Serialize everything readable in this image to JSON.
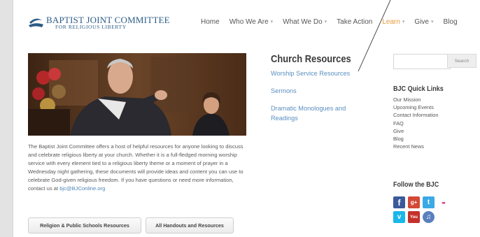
{
  "brand": {
    "title": "BAPTIST JOINT COMMITTEE",
    "subtitle": "FOR RELIGIOUS LIBERTY"
  },
  "nav": [
    {
      "label": "Home",
      "dropdown": false
    },
    {
      "label": "Who We Are",
      "dropdown": true
    },
    {
      "label": "What We Do",
      "dropdown": true
    },
    {
      "label": "Take Action",
      "dropdown": false
    },
    {
      "label": "Learn",
      "dropdown": true,
      "active": true
    },
    {
      "label": "Give",
      "dropdown": true
    },
    {
      "label": "Blog",
      "dropdown": false
    }
  ],
  "content": {
    "intro_text": "The Baptist Joint Committee offers a host of helpful resources for anyone looking to discuss and celebrate religious liberty at your church. Whether it is a full-fledged morning worship service with every element tied to a religious liberty theme or a moment of prayer in a Wednesday night gathering, these documents will provide ideas and content you can use to celebrate God-given religious freedom. If you have questions or need more information, contact us at",
    "email": "bjc@BJConline.org",
    "button_1": "Religion & Public Schools Resources",
    "button_2": "All Handouts and Resources"
  },
  "resources": {
    "title": "Church Resources",
    "links": [
      "Worship Service Resources",
      "Sermons",
      "Dramatic Monologues and Readings"
    ]
  },
  "sidebar": {
    "search_button": "Search",
    "search_placeholder": "",
    "quick_links_title": "BJC Quick Links",
    "quick_links": [
      "Our Mission",
      "Upcoming Events",
      "Contact Information",
      "FAQ",
      "Give",
      "Blog",
      "Recent News"
    ],
    "follow_title": "Follow the BJC",
    "social": [
      {
        "icon": "facebook-icon",
        "glyph": "f",
        "color": "#3b5a99"
      },
      {
        "icon": "google-plus-icon",
        "glyph": "g+",
        "color": "#d34836"
      },
      {
        "icon": "twitter-icon",
        "glyph": "t",
        "color": "#3aa9e6"
      },
      {
        "icon": "flickr-icon",
        "glyph": "••",
        "color": "#ffffff"
      },
      {
        "icon": "vimeo-icon",
        "glyph": "v",
        "color": "#1ab7ea"
      },
      {
        "icon": "youtube-icon",
        "glyph": "You",
        "color": "#c4302b"
      },
      {
        "icon": "itunes-icon",
        "glyph": "♫",
        "color": "#5a7fbe"
      }
    ]
  }
}
